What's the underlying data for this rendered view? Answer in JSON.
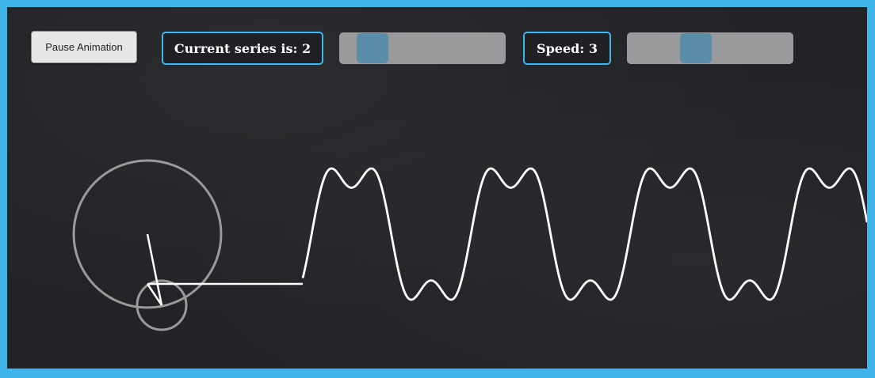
{
  "controls": {
    "pause_button": "Pause Animation",
    "series_label": "Current series is: 2",
    "series_value": 2,
    "series_level": 0.07,
    "speed_label": "Speed: 3",
    "speed_value": 3,
    "speed_level": 0.2
  },
  "colors": {
    "frame": "#42b4ec",
    "board": "#222326",
    "wave": "#ffffff",
    "circle": "#9a9a9a",
    "slider_track": "#9a9a9c",
    "slider_thumb": "#5a8ea8"
  },
  "visualization": {
    "type": "fourier-series-epicycles",
    "terms": 2,
    "harmonics": [
      1,
      3
    ]
  }
}
